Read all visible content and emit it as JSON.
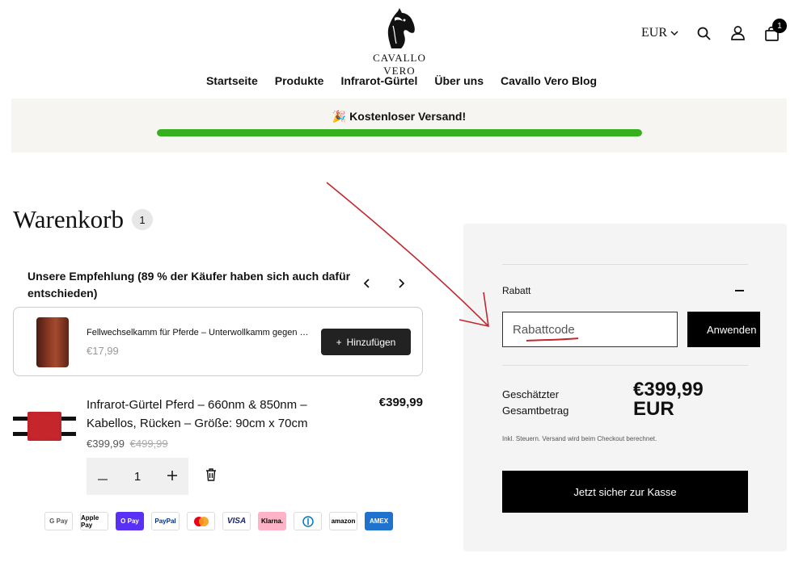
{
  "header": {
    "brand": "CAVALLO VERO",
    "currency": "EUR",
    "cart_count": "1"
  },
  "nav": {
    "items": [
      "Startseite",
      "Produkte",
      "Infrarot-Gürtel",
      "Über uns",
      "Cavallo Vero Blog"
    ]
  },
  "shipping": {
    "text": "🎉 Kostenloser Versand!",
    "progress": 1.0,
    "color": "#36b01f"
  },
  "cart": {
    "title": "Warenkorb",
    "count": "1",
    "recommendation": {
      "title": "Unsere Empfehlung (89 % der Käufer haben sich auch dafür entschieden)",
      "product_name": "Fellwechselkamm für Pferde – Unterwollkamm gegen Haarausfall",
      "price": "€17,99",
      "add_label": "Hinzufügen"
    },
    "item": {
      "name": "Infrarot-Gürtel Pferd – 660nm & 850nm – Kabellos, Rücken – Größe: 90cm x 70cm",
      "line_total": "€399,99",
      "price": "€399,99",
      "compare_price": "€499,99",
      "quantity": "1"
    },
    "payments": [
      "G Pay",
      "Apple Pay",
      "O Pay",
      "PayPal",
      "Mastercard",
      "VISA",
      "Klarna.",
      "Diners",
      "amazon",
      "AMEX"
    ]
  },
  "summary": {
    "discount_label": "Rabatt",
    "discount_placeholder": "Rabattcode",
    "apply_label": "Anwenden",
    "total_label": "Geschätzter Gesamtbetrag",
    "total_value": "€399,99 EUR",
    "tax_note": "Inkl. Steuern. Versand wird beim Checkout berechnet.",
    "checkout_label": "Jetzt sicher zur Kasse"
  },
  "colors": {
    "accent": "#000000",
    "progress": "#36b01f",
    "annotation": "#c0282d"
  }
}
